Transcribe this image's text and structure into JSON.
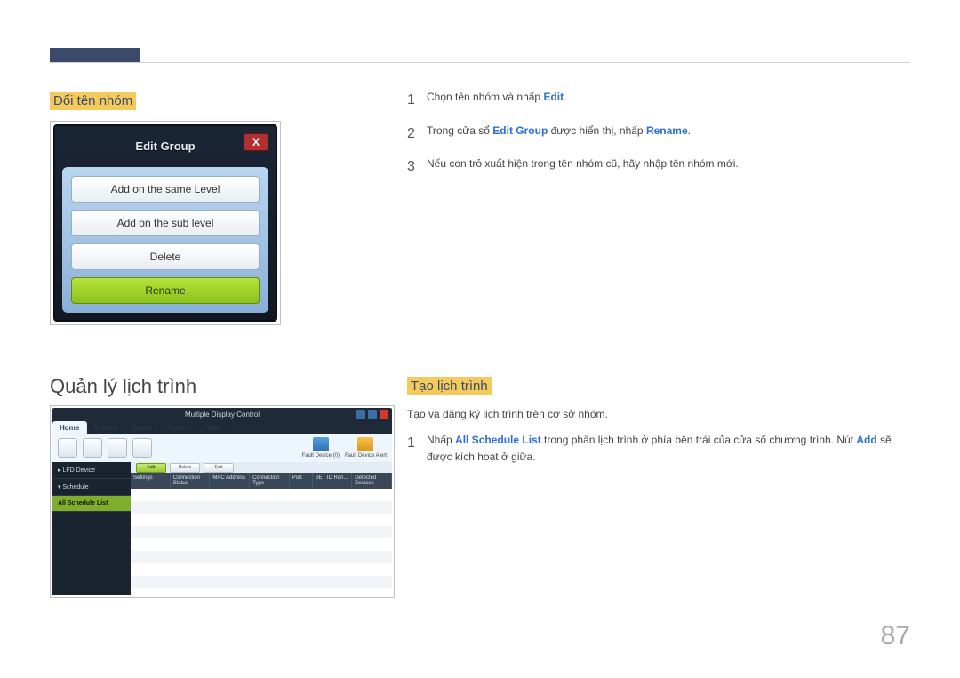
{
  "page_number": "87",
  "left": {
    "heading_rename": "Đổi tên nhóm",
    "heading_schedule_manage": "Quản lý lịch trình"
  },
  "right": {
    "heading_create_schedule": "Tạo lịch trình",
    "create_desc": "Tạo và đăng ký lịch trình trên cơ sở nhóm."
  },
  "steps_rename": [
    {
      "num": "1",
      "pre": "Chọn tên nhóm và nhấp ",
      "bold": "Edit",
      "post": "."
    },
    {
      "num": "2",
      "pre": "Trong cửa sổ ",
      "bold": "Edit Group",
      "mid": " được hiển thị, nhấp ",
      "bold2": "Rename",
      "post": "."
    },
    {
      "num": "3",
      "pre": "Nếu con trỏ xuất hiện trong tên nhóm cũ, hãy nhập tên nhóm mới.",
      "bold": "",
      "post": ""
    }
  ],
  "steps_create": [
    {
      "num": "1",
      "pre": "Nhấp ",
      "bold": "All Schedule List",
      "mid": " trong phần lịch trình ở phía bên trái của cửa sổ chương trình. Nút ",
      "bold2": "Add",
      "post": " sẽ được kích hoạt ở giữa."
    }
  ],
  "edit_group_dialog": {
    "title": "Edit Group",
    "close": "X",
    "btn_same": "Add on the same Level",
    "btn_sub": "Add on the sub level",
    "btn_delete": "Delete",
    "btn_rename": "Rename"
  },
  "mdc": {
    "title": "Multiple Display Control",
    "tabs": [
      "Home",
      "Picture",
      "Sound",
      "System",
      "Tool"
    ],
    "fault1": "Fault Device (0)",
    "fault2": "Fault Device Alert",
    "side": {
      "lfd": "▸ LFD Device",
      "schedule": "▾ Schedule",
      "all_list": "All Schedule List"
    },
    "toolbar": {
      "add": "Add",
      "b2": "Delete",
      "b3": "Edit"
    },
    "columns": [
      "Settings",
      "Connection Status",
      "MAC Address",
      "Connection Type",
      "Port",
      "SET ID Ran...",
      "Detected Devices"
    ]
  }
}
